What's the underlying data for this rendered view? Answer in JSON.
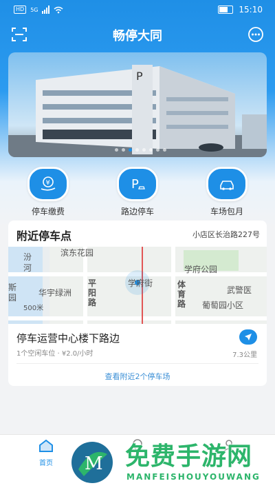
{
  "status_bar": {
    "network_chip": "HD",
    "signal_label": "5G",
    "time": "15:10"
  },
  "app": {
    "title": "畅停大同"
  },
  "banner": {
    "slide_count": 8,
    "active_index": 2
  },
  "quick_actions": [
    {
      "label": "停车缴费",
      "icon": "yuan-hand-icon"
    },
    {
      "label": "路边停车",
      "icon": "parking-p-icon"
    },
    {
      "label": "车场包月",
      "icon": "car-icon"
    }
  ],
  "nearby": {
    "title": "附近停车点",
    "address": "小店区长治路227号",
    "map_labels": [
      "滨东花园",
      "汾",
      "河",
      "学府公园",
      "斯",
      "园",
      "华宇绿洲",
      "平",
      "阳",
      "路",
      "学府街",
      "体",
      "育",
      "路",
      "武警医",
      "葡萄园小区",
      "500米"
    ],
    "lot_name": "停车运营中心楼下路边",
    "lot_info": "1个空闲车位 · ¥2.0/小时",
    "distance": "7.3公里",
    "view_more": "查看附近2个停车场"
  },
  "tabs": [
    {
      "label": "首页",
      "icon": "home-icon"
    },
    {
      "label": "",
      "icon": "location-icon"
    },
    {
      "label": "",
      "icon": "profile-icon"
    }
  ],
  "watermark": {
    "text": "免费手游网",
    "sub": "MANFEISHOUYOUWANG",
    "logo_letter": "M"
  },
  "colors": {
    "primary": "#1e8fe6",
    "watermark": "#2db56b"
  }
}
